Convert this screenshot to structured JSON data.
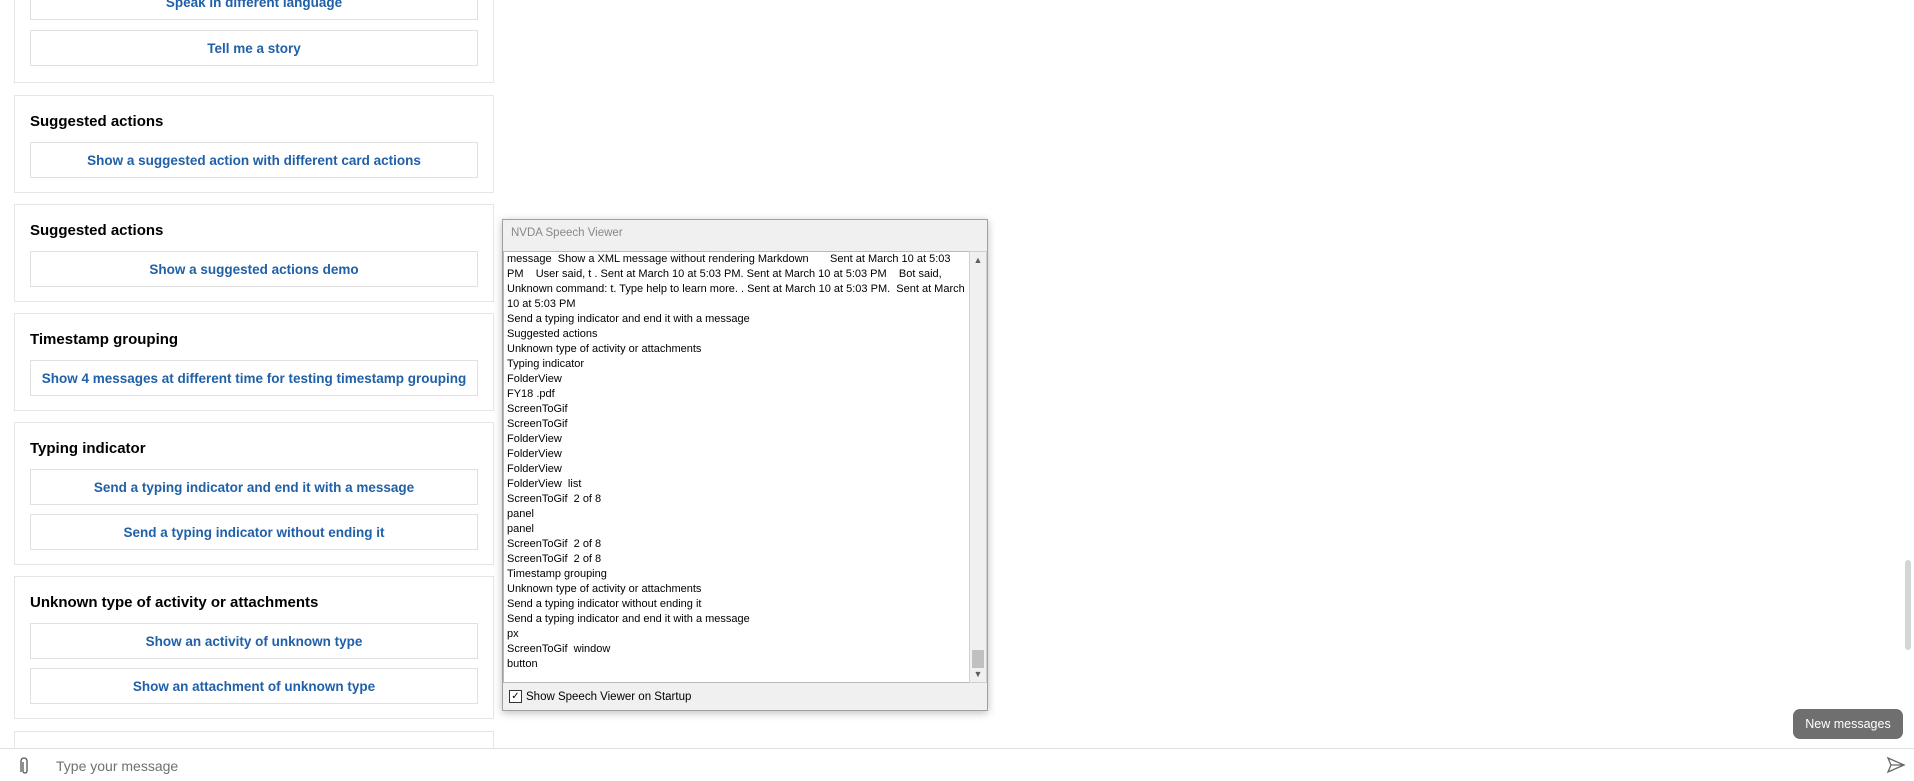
{
  "cards": [
    {
      "title": "",
      "buttons": [
        "Speak in different language",
        "Tell me a story"
      ]
    },
    {
      "title": "Suggested actions",
      "buttons": [
        "Show a suggested action with different card actions"
      ]
    },
    {
      "title": "Suggested actions",
      "buttons": [
        "Show a suggested actions demo"
      ]
    },
    {
      "title": "Timestamp grouping",
      "buttons": [
        "Show 4 messages at different time for testing timestamp grouping"
      ]
    },
    {
      "title": "Typing indicator",
      "buttons": [
        "Send a typing indicator and end it with a message",
        "Send a typing indicator without ending it"
      ]
    },
    {
      "title": "Unknown type of activity or attachments",
      "buttons": [
        "Show an activity of unknown type",
        "Show an attachment of unknown type"
      ]
    }
  ],
  "nvda": {
    "title": "NVDA Speech Viewer",
    "lines": [
      "message  Show a XML message without rendering Markdown       Sent at March 10 at 5:03 PM    User said, t . Sent at March 10 at 5:03 PM. Sent at March 10 at 5:03 PM    Bot said, Unknown command: t. Type help to learn more. . Sent at March 10 at 5:03 PM.  Sent at March 10 at 5:03 PM",
      "Send a typing indicator and end it with a message",
      "Suggested actions",
      "Unknown type of activity or attachments",
      "Typing indicator",
      "FolderView",
      "FY18 .pdf",
      "ScreenToGif",
      "ScreenToGif",
      "FolderView",
      "FolderView",
      "FolderView",
      "FolderView  list",
      "ScreenToGif  2 of 8",
      "panel",
      "panel",
      "ScreenToGif  2 of 8",
      "ScreenToGif  2 of 8",
      "Timestamp grouping",
      "Unknown type of activity or attachments",
      "Send a typing indicator without ending it",
      "Send a typing indicator and end it with a message",
      "px",
      "ScreenToGif  window",
      "button"
    ],
    "checkbox_label": "Show Speech Viewer on Startup",
    "checkbox_checked": true
  },
  "composer": {
    "placeholder": "Type your message",
    "attach_icon": "paperclip-icon",
    "send_icon": "send-icon"
  },
  "new_messages_label": "New messages"
}
